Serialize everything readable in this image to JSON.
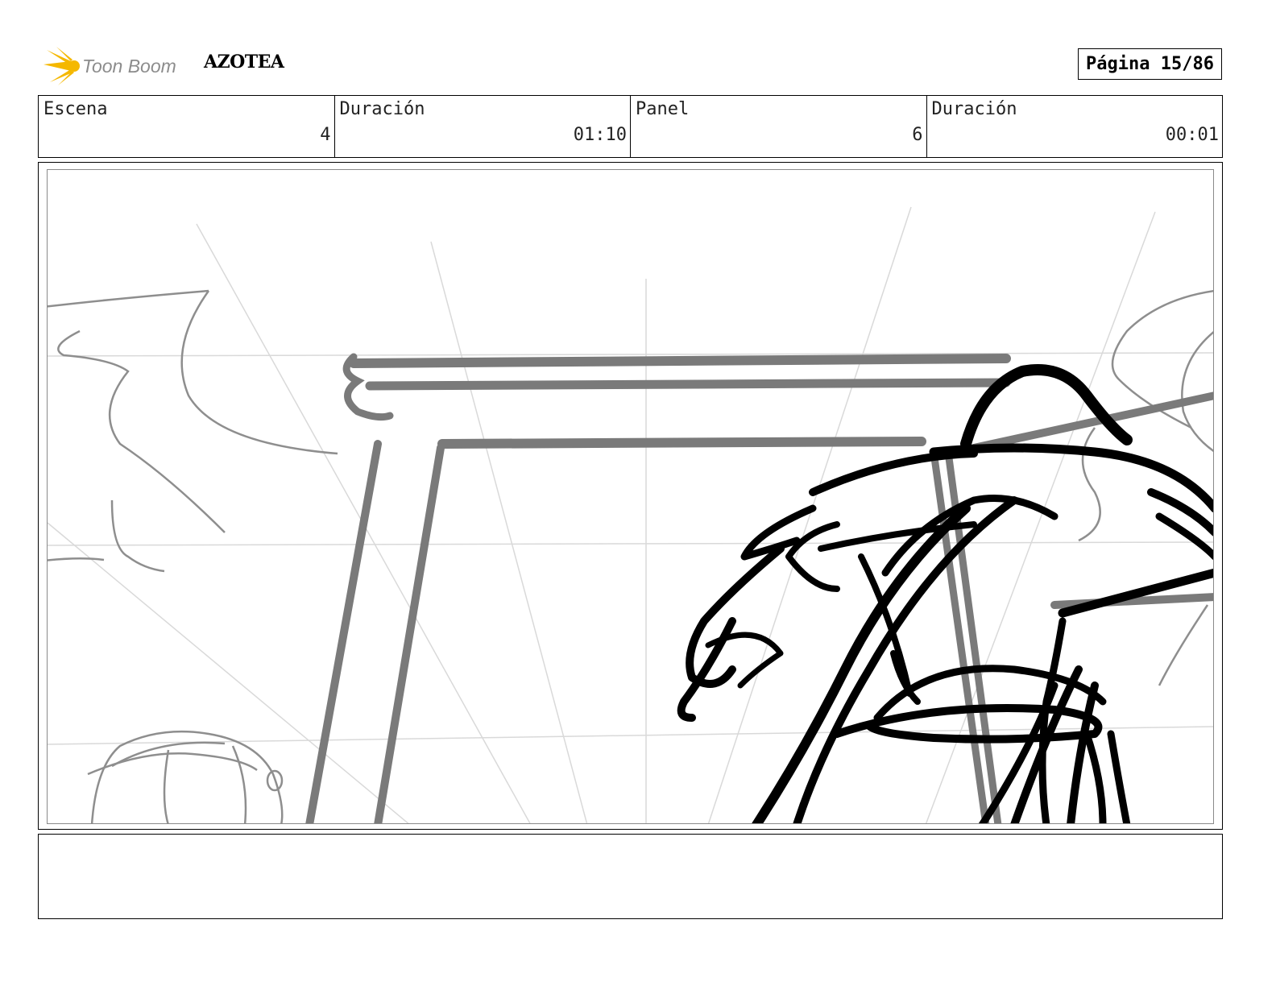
{
  "header": {
    "brand": "Toon Boom",
    "project_title": "AZOTEA",
    "page_label": "Página 15/86"
  },
  "info": {
    "scene_label": "Escena",
    "scene_value": "4",
    "scene_duration_label": "Duración",
    "scene_duration_value": "01:10",
    "panel_label": "Panel",
    "panel_value": "6",
    "panel_duration_label": "Duración",
    "panel_duration_value": "00:01"
  },
  "caption": {
    "text": ""
  },
  "colors": {
    "logo_yellow": "#f5b800",
    "logo_gray": "#8c8c8c",
    "sketch_black": "#000000",
    "sketch_gray": "#7a7a7a",
    "guide_gray": "#d6d6d6"
  }
}
